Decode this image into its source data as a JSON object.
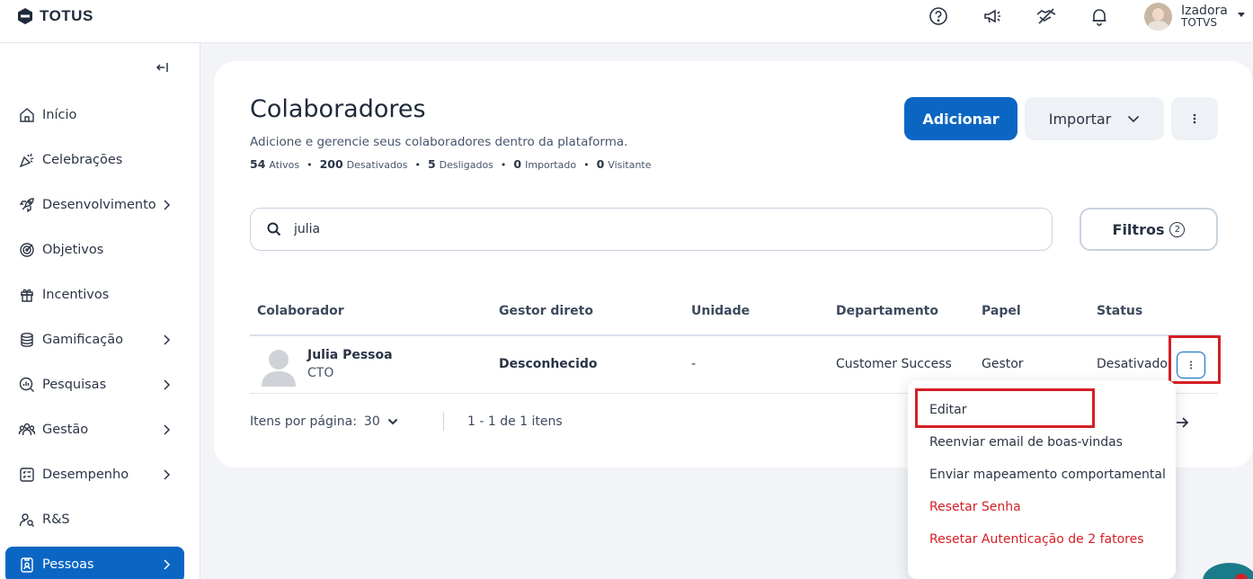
{
  "brand": {
    "name": "TOTUS"
  },
  "user": {
    "name": "Izadora",
    "org": "TOTVS"
  },
  "topbar_icons": [
    "help-icon",
    "megaphone-icon",
    "handshake-icon",
    "bell-icon"
  ],
  "sidebar": {
    "items": [
      {
        "label": "Início",
        "icon": "home-icon",
        "chevron": false
      },
      {
        "label": "Celebrações",
        "icon": "party-icon",
        "chevron": false
      },
      {
        "label": "Desenvolvimento",
        "icon": "rocket-icon",
        "chevron": true
      },
      {
        "label": "Objetivos",
        "icon": "target-icon",
        "chevron": false
      },
      {
        "label": "Incentivos",
        "icon": "gift-icon",
        "chevron": false
      },
      {
        "label": "Gamificação",
        "icon": "coins-icon",
        "chevron": true
      },
      {
        "label": "Pesquisas",
        "icon": "survey-icon",
        "chevron": true
      },
      {
        "label": "Gestão",
        "icon": "team-icon",
        "chevron": true
      },
      {
        "label": "Desempenho",
        "icon": "checklist-icon",
        "chevron": true
      },
      {
        "label": "R&S",
        "icon": "people-search-icon",
        "chevron": false
      },
      {
        "label": "Pessoas",
        "icon": "badge-icon",
        "chevron": true,
        "active": true
      }
    ]
  },
  "page": {
    "title": "Colaboradores",
    "subtitle": "Adicione e gerencie seus colaboradores dentro da plataforma.",
    "stats": [
      {
        "value": "54",
        "label": "Ativos"
      },
      {
        "value": "200",
        "label": "Desativados"
      },
      {
        "value": "5",
        "label": "Desligados"
      },
      {
        "value": "0",
        "label": "Importado"
      },
      {
        "value": "0",
        "label": "Visitante"
      }
    ],
    "add_label": "Adicionar",
    "import_label": "Importar"
  },
  "search": {
    "value": "julia",
    "placeholder": ""
  },
  "filters": {
    "label": "Filtros",
    "count": "2"
  },
  "table": {
    "columns": [
      "Colaborador",
      "Gestor direto",
      "Unidade",
      "Departamento",
      "Papel",
      "Status"
    ],
    "rows": [
      {
        "name": "Julia Pessoa",
        "role": "CTO",
        "manager": "Desconhecido",
        "unit": "-",
        "department": "Customer Success",
        "paper": "Gestor",
        "status": "Desativado"
      }
    ]
  },
  "pagination": {
    "per_page_label": "Itens por página:",
    "per_page_value": "30",
    "range": "1 - 1 de 1 itens"
  },
  "row_menu": {
    "items": [
      {
        "label": "Editar",
        "danger": false
      },
      {
        "label": "Reenviar email de boas-vindas",
        "danger": false
      },
      {
        "label": "Enviar mapeamento comportamental",
        "danger": false
      },
      {
        "label": "Resetar Senha",
        "danger": true
      },
      {
        "label": "Resetar Autenticação de 2 fatores",
        "danger": true
      }
    ]
  },
  "colors": {
    "primary": "#0b66c3",
    "danger": "#d41f25",
    "text": "#2b3445"
  }
}
